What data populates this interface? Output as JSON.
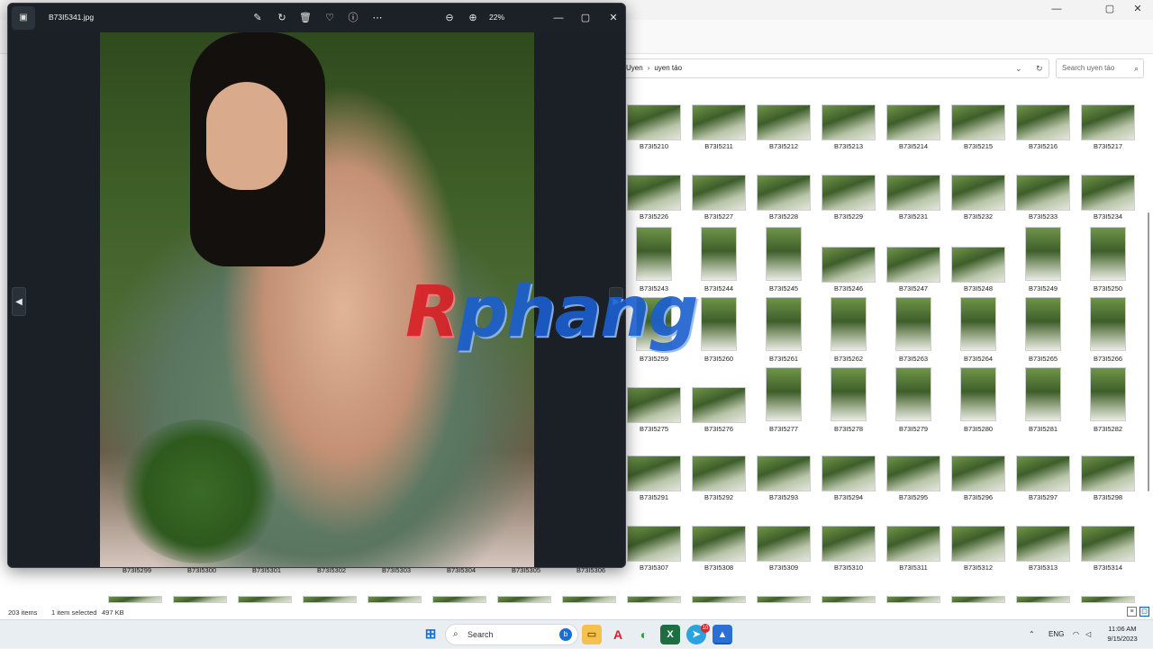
{
  "explorer": {
    "window_controls": {
      "minimize": "—",
      "maximize": "▢",
      "close": "✕"
    },
    "breadcrumb": [
      "Uyen",
      "uyen táo"
    ],
    "search_placeholder": "Search uyen táo",
    "rows": [
      [
        "B73I5210",
        "B73I5211",
        "B73I5212",
        "B73I5213",
        "B73I5214",
        "B73I5215",
        "B73I5216",
        "B73I5217"
      ],
      [
        "B73I5226",
        "B73I5227",
        "B73I5228",
        "B73I5229",
        "B73I5231",
        "B73I5232",
        "B73I5233",
        "B73I5234"
      ],
      [
        "B73I5243",
        "B73I5244",
        "B73I5245",
        "B73I5246",
        "B73I5247",
        "B73I5248",
        "B73I5249",
        "B73I5250"
      ],
      [
        "B73I5259",
        "B73I5260",
        "B73I5261",
        "B73I5262",
        "B73I5263",
        "B73I5264",
        "B73I5265",
        "B73I5266"
      ],
      [
        "B73I5275",
        "B73I5276",
        "B73I5277",
        "B73I5278",
        "B73I5279",
        "B73I5280",
        "B73I5281",
        "B73I5282"
      ],
      [
        "B73I5291",
        "B73I5292",
        "B73I5293",
        "B73I5294",
        "B73I5295",
        "B73I5296",
        "B73I5297",
        "B73I5298"
      ],
      [
        "B73I5307",
        "B73I5308",
        "B73I5309",
        "B73I5310",
        "B73I5311",
        "B73I5312",
        "B73I5313",
        "B73I5314"
      ]
    ],
    "row_portrait": [
      [
        false,
        false,
        false,
        false,
        false,
        false,
        false,
        false
      ],
      [
        false,
        false,
        false,
        false,
        false,
        false,
        false,
        false
      ],
      [
        true,
        true,
        true,
        false,
        false,
        false,
        true,
        true
      ],
      [
        true,
        true,
        true,
        true,
        true,
        true,
        true,
        true
      ],
      [
        false,
        false,
        true,
        true,
        true,
        true,
        true,
        true
      ],
      [
        false,
        false,
        false,
        false,
        false,
        false,
        false,
        false
      ],
      [
        false,
        false,
        false,
        false,
        false,
        false,
        false,
        false
      ]
    ],
    "left_row_labels": [
      "B73I5299",
      "B73I5300",
      "B73I5301",
      "B73I5302",
      "B73I5303",
      "B73I5304",
      "B73I5305",
      "B73I5306"
    ],
    "status": {
      "count": "203 items",
      "selected": "1 item selected",
      "size": "497 KB"
    }
  },
  "photos": {
    "file_name": "B73I5341.jpg",
    "zoom": "22%",
    "toolbar_icons": [
      "edit-icon",
      "rotate-icon",
      "delete-icon",
      "favorite-icon",
      "info-icon",
      "more-icon"
    ],
    "window_controls": {
      "minimize": "—",
      "maximize": "▢",
      "close": "✕"
    },
    "nav": {
      "prev": "◀",
      "next": "▶"
    }
  },
  "watermark": {
    "first": "R",
    "rest": "phang"
  },
  "taskbar": {
    "search_label": "Search",
    "language": "ENG",
    "time": "11:06 AM",
    "date": "9/15/2023",
    "telegram_badge": "10"
  },
  "colors": {
    "accent": "#0a5ec2",
    "photos_bg": "#1b2026",
    "watermark_red": "#d81f26",
    "watermark_blue": "#1a5fd0"
  }
}
